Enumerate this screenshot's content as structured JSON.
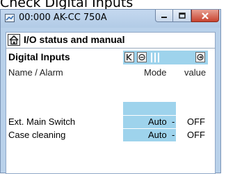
{
  "caption": "Check Digital Inputs",
  "window": {
    "title": "00:000 AK-CC 750A",
    "controls": {
      "minimize_icon": "minimize-icon",
      "maximize_icon": "maximize-icon",
      "close_icon": "close-icon"
    }
  },
  "screen": {
    "title": "I/O status and manual",
    "section": "Digital Inputs",
    "columns": {
      "name": "Name / Alarm",
      "mode": "Mode",
      "value": "value"
    },
    "rows": [
      {
        "name": "Ext. Main Switch",
        "mode": "Auto",
        "sep": "-",
        "value": "OFF"
      },
      {
        "name": "Case cleaning",
        "mode": "Auto",
        "sep": "-",
        "value": "OFF"
      }
    ]
  },
  "colors": {
    "window_frame": "#b9d1ea",
    "highlight": "#9ed3ec",
    "close_button": "#c7432f"
  }
}
